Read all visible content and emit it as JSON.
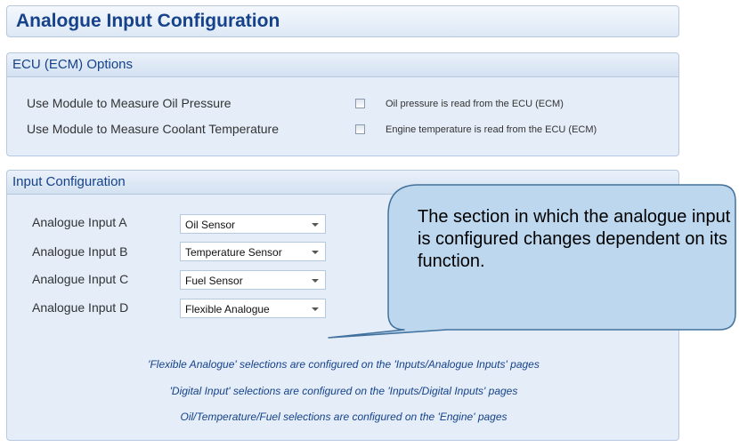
{
  "header": {
    "title": "Analogue Input Configuration"
  },
  "ecu_options": {
    "title": "ECU (ECM) Options",
    "rows": [
      {
        "label": "Use Module to Measure Oil Pressure",
        "checked": false,
        "description": "Oil pressure is read from the ECU (ECM)"
      },
      {
        "label": "Use Module to Measure Coolant Temperature",
        "checked": false,
        "description": "Engine temperature is read from the ECU (ECM)"
      }
    ]
  },
  "input_configuration": {
    "title": "Input Configuration",
    "inputs": [
      {
        "label": "Analogue Input A",
        "value": "Oil Sensor"
      },
      {
        "label": "Analogue Input B",
        "value": "Temperature Sensor"
      },
      {
        "label": "Analogue Input C",
        "value": "Fuel Sensor"
      },
      {
        "label": "Analogue Input D",
        "value": "Flexible Analogue"
      }
    ],
    "notes": [
      "'Flexible Analogue' selections are configured on the 'Inputs/Analogue Inputs' pages",
      "'Digital Input' selections are configured on the 'Inputs/Digital Inputs' pages",
      "Oil/Temperature/Fuel selections are configured on the 'Engine' pages"
    ]
  },
  "callout": {
    "text": "The section in which the analogue input is configured changes dependent on its function."
  },
  "colors": {
    "accent": "#15428b",
    "panel": "#e4edf8",
    "border": "#b6c8df",
    "callout_fill": "#bdd7ee",
    "callout_border": "#41719c"
  }
}
